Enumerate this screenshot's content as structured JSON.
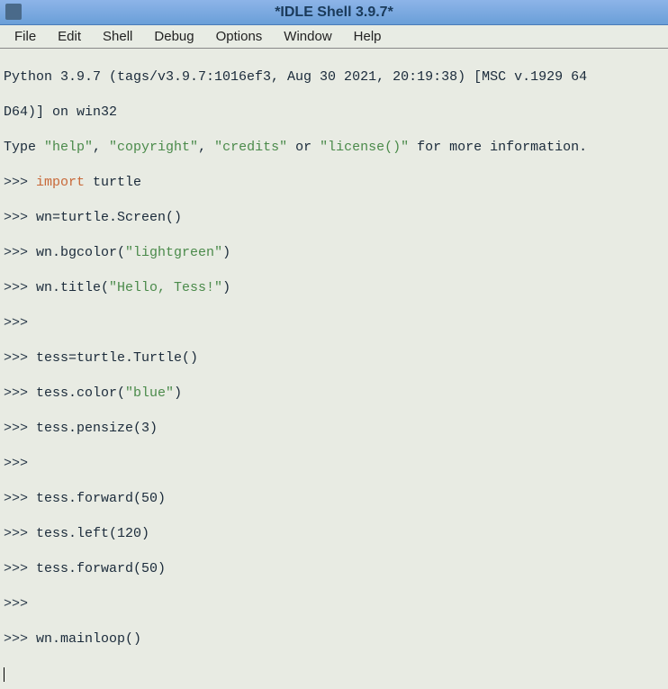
{
  "titlebar": {
    "title": "*IDLE Shell 3.9.7*"
  },
  "menubar": {
    "items": [
      "File",
      "Edit",
      "Shell",
      "Debug",
      "Options",
      "Window",
      "Help"
    ]
  },
  "content": {
    "header_line1": "Python 3.9.7 (tags/v3.9.7:1016ef3, Aug 30 2021, 20:19:38) [MSC v.1929 64",
    "header_line2": "D64)] on win32",
    "header_line3_prefix": "Type ",
    "header_line3_help": "\"help\"",
    "header_line3_mid1": ", ",
    "header_line3_copyright": "\"copyright\"",
    "header_line3_mid2": ", ",
    "header_line3_credits": "\"credits\"",
    "header_line3_mid3": " or ",
    "header_line3_license": "\"license()\"",
    "header_line3_suffix": " for more information.",
    "prompt": ">>> ",
    "lines": [
      {
        "kw": "import",
        "rest": " turtle"
      },
      {
        "rest": "wn=turtle.Screen()"
      },
      {
        "rest": "wn.bgcolor(",
        "str": "\"lightgreen\"",
        "rest2": ")"
      },
      {
        "rest": "wn.title(",
        "str": "\"Hello, Tess!\"",
        "rest2": ")"
      },
      {
        "empty": true
      },
      {
        "rest": "tess=turtle.Turtle()"
      },
      {
        "rest": "tess.color(",
        "str": "\"blue\"",
        "rest2": ")"
      },
      {
        "rest": "tess.pensize(3)"
      },
      {
        "empty": true
      },
      {
        "rest": "tess.forward(50)"
      },
      {
        "rest": "tess.left(120)"
      },
      {
        "rest": "tess.forward(50)"
      },
      {
        "empty": true
      },
      {
        "rest": "wn.mainloop()"
      }
    ]
  }
}
